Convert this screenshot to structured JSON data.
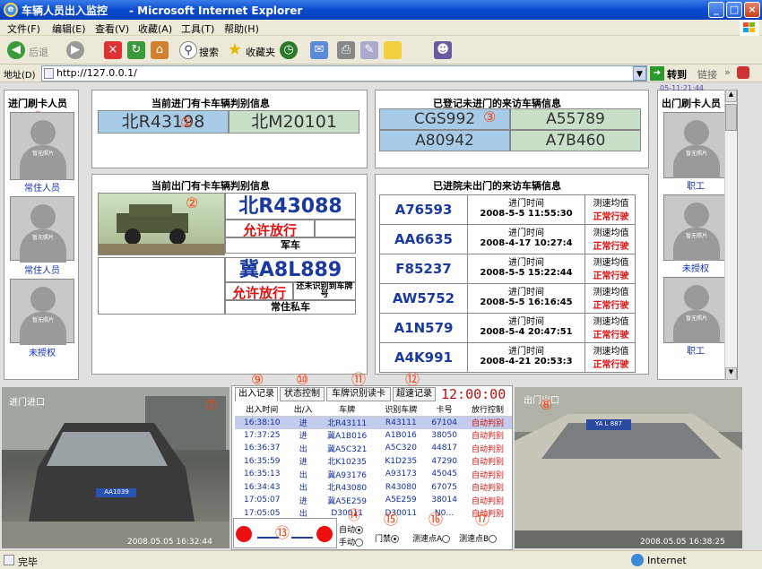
{
  "window": {
    "title": "车辆人员出入监控　　- Microsoft Internet Explorer"
  },
  "menu": [
    "文件(F)",
    "编辑(E)",
    "查看(V)",
    "收藏(A)",
    "工具(T)",
    "帮助(H)"
  ],
  "toolbar": {
    "back": "后退",
    "search": "搜索",
    "favorites": "收藏夹"
  },
  "address": {
    "label": "地址(D)",
    "url": "http://127.0.0.1/",
    "go": "转到",
    "links": "链接"
  },
  "entry_card": {
    "title": "当前进门有卡车辆判别信息",
    "plates": [
      "北R43198",
      "北M20101"
    ],
    "marker": "①"
  },
  "visitor_registered": {
    "title": "已登记未进门的来访车辆信息",
    "plates": [
      "CGS992",
      "A55789",
      "A80942",
      "A7B460"
    ],
    "marker": "③"
  },
  "left_persons": {
    "title": "进门刷卡人员",
    "marker": "⑤",
    "photo_text": "暂无照片",
    "labels": [
      "常住人员",
      "常住人员",
      "未授权"
    ]
  },
  "right_persons": {
    "title": "出门刷卡人员",
    "timestamp": "05-11:21:44",
    "marker": "⑥",
    "photo_text": "暂无照片",
    "labels": [
      "职工",
      "未授权",
      "职工"
    ]
  },
  "exit_card": {
    "title": "当前出门有卡车辆判别信息",
    "marker": "②",
    "vehicle1": {
      "plate": "北R43088",
      "status": "允许放行",
      "type": "军车"
    },
    "vehicle2": {
      "plate": "冀A8L889",
      "status": "允许放行",
      "note": "还未识别到车牌号",
      "type": "常住私车"
    }
  },
  "inside_visitors": {
    "title": "已进院未出门的来访车辆信息",
    "marker": "④",
    "col_time": "进门时间",
    "col_speed": "测速均值",
    "rows": [
      {
        "plate": "A76593",
        "time": "2008-5-5 11:55:30",
        "speed": "正常行驶"
      },
      {
        "plate": "AA6635",
        "time": "2008-4-17 10:27:4",
        "speed": "正常行驶"
      },
      {
        "plate": "F85237",
        "time": "2008-5-5 15:22:44",
        "speed": "正常行驶"
      },
      {
        "plate": "AW5752",
        "time": "2008-5-5 16:16:45",
        "speed": "正常行驶"
      },
      {
        "plate": "A1N579",
        "time": "2008-5-4 20:47:51",
        "speed": "正常行驶"
      },
      {
        "plate": "A4K991",
        "time": "2008-4-21 20:53:3",
        "speed": "正常行驶"
      }
    ]
  },
  "tabs": {
    "items": [
      "出入记录",
      "状态控制",
      "车牌识别读卡",
      "超速记录"
    ],
    "markers": [
      "⑨",
      "⑩",
      "⑪",
      "⑫"
    ],
    "clock": "12:00:00"
  },
  "cameras": {
    "in_label": "进门进口",
    "in_marker": "⑦",
    "in_time": "2008.05.05 16:32:44",
    "in_plate": "AA1039",
    "out_label": "出门出口",
    "out_marker": "⑧",
    "out_time": "2008.05.05 16:38:25",
    "out_plate": "YA L 887"
  },
  "log": {
    "headers": [
      "出入时间",
      "出/入",
      "车牌",
      "识别车牌",
      "卡号",
      "放行控制"
    ],
    "rows": [
      [
        "16:38:10",
        "进",
        "北R43111",
        "R43111",
        "67104",
        "自动判别"
      ],
      [
        "17:37:25",
        "进",
        "冀A1B016",
        "A1B016",
        "38050",
        "自动判别"
      ],
      [
        "16:36:37",
        "出",
        "冀A5C321",
        "A5C320",
        "44817",
        "自动判别"
      ],
      [
        "16:35:59",
        "进",
        "北K10235",
        "K1D235",
        "47290",
        "自动判别"
      ],
      [
        "16:35:13",
        "出",
        "冀A93176",
        "A93173",
        "45045",
        "自动判别"
      ],
      [
        "16:34:43",
        "出",
        "北R43080",
        "R43080",
        "67075",
        "自动判别"
      ],
      [
        "17:05:07",
        "进",
        "冀A5E259",
        "A5E259",
        "38014",
        "自动判别"
      ],
      [
        "17:05:05",
        "出",
        "D30011",
        "D30011",
        "N0…",
        "自动判别"
      ]
    ]
  },
  "controls": {
    "marker13": "⑬",
    "marker14": "⑭",
    "marker15": "⑮",
    "marker16": "⑯",
    "marker17": "⑰",
    "auto": "自动",
    "manual": "手动",
    "gate": "门禁",
    "speedA": "测速点A",
    "speedB": "测速点B"
  },
  "status": {
    "left": "完毕",
    "zone": "Internet"
  },
  "colors": {
    "plate_bg_green": "#c8e0c8",
    "plate_bg_blue": "#a8cce8",
    "accent_red": "#ff4010"
  }
}
